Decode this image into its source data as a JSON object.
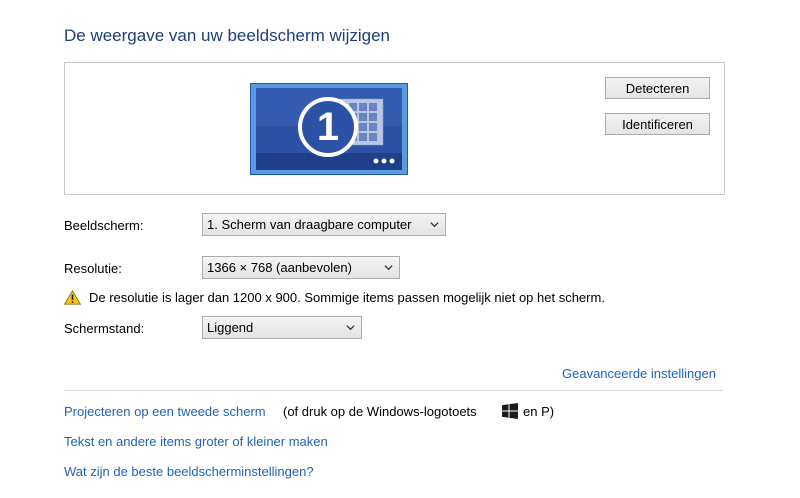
{
  "page": {
    "title": "De weergave van uw beeldscherm wijzigen"
  },
  "preview": {
    "monitor_number": "1",
    "detect_label": "Detecteren",
    "identify_label": "Identificeren"
  },
  "settings": {
    "display_label": "Beeldscherm:",
    "display_value": "1. Scherm van draagbare computer",
    "resolution_label": "Resolutie:",
    "resolution_value": "1366 × 768 (aanbevolen)",
    "warning_text": "De resolutie is lager dan 1200 x 900. Sommige items passen mogelijk niet op het scherm.",
    "orientation_label": "Schermstand:",
    "orientation_value": "Liggend",
    "advanced_link": "Geavanceerde instellingen"
  },
  "links": {
    "project_link": "Projecteren op een tweede scherm",
    "project_suffix_a": "(of druk op de Windows-logotoets",
    "project_suffix_b": "en P)",
    "text_size_link": "Tekst en andere items groter of kleiner maken",
    "best_settings_link": "Wat zijn de beste beeldscherminstellingen?"
  },
  "icons": {
    "warning": "warning-icon",
    "windows": "windows-logo-icon",
    "chevron": "chevron-down-icon"
  },
  "colors": {
    "title": "#1f3d7a",
    "link": "#1e64b4",
    "monitor_frame": "#3a78c8",
    "monitor_screen": "#274c9c"
  }
}
